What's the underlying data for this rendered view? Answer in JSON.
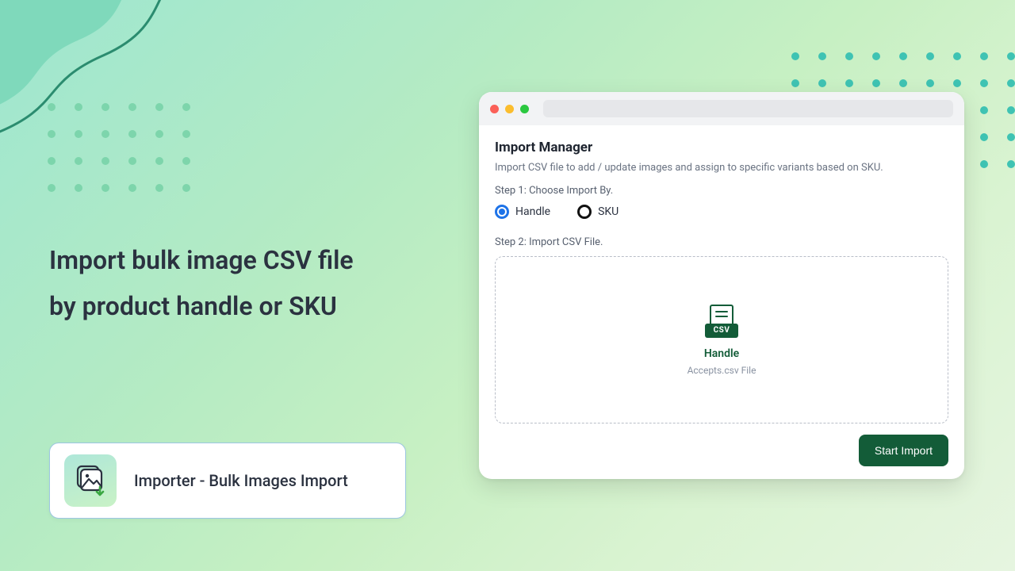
{
  "hero": {
    "headline_line1": "Import bulk image CSV file",
    "headline_line2": "by product handle or SKU"
  },
  "badge": {
    "app_name": "Importer - Bulk Images Import"
  },
  "window": {
    "title": "Import Manager",
    "subtitle": "Import CSV file to add / update images and assign to specific  variants based on SKU.",
    "step1_label": "Step 1: Choose Import By.",
    "radio_handle_label": "Handle",
    "radio_sku_label": "SKU",
    "step2_label": "Step 2: Import CSV File.",
    "drop_title": "Handle",
    "drop_subtitle": "Accepts.csv File",
    "csv_badge_text": "CSV",
    "start_button": "Start Import"
  }
}
